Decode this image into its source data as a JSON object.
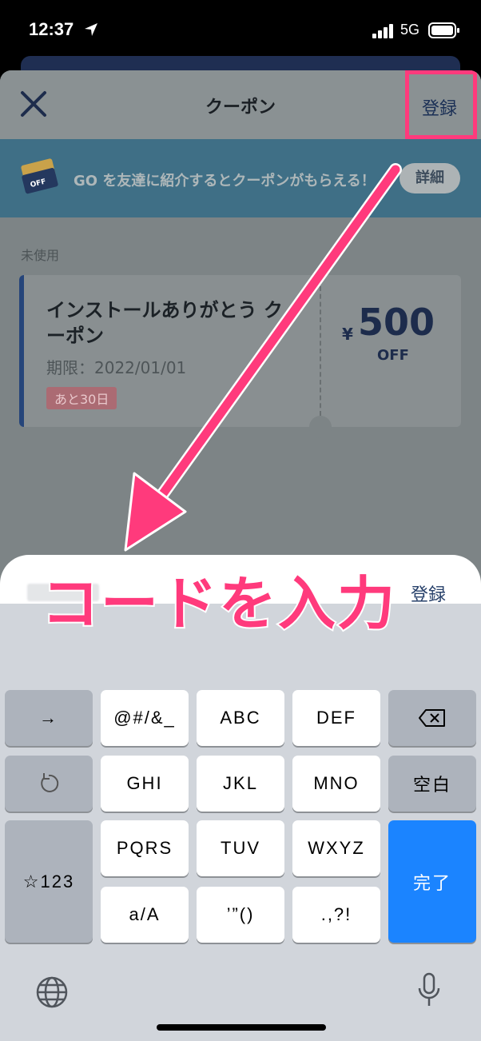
{
  "status_bar": {
    "time": "12:37",
    "network": "5G"
  },
  "header": {
    "title": "クーポン",
    "register_label": "登録"
  },
  "banner": {
    "text": "GO を友達に紹介するとクーポンがもらえる！",
    "details_label": "詳細",
    "ticket_text": "OFF"
  },
  "section_label": "未使用",
  "coupon": {
    "title": "インストールありがとう クーポン",
    "expiry": "期限：2022/01/01",
    "badge": "あと30日",
    "currency": "¥",
    "amount": "500",
    "off_label": "OFF"
  },
  "code_entry": {
    "register_label": "登録"
  },
  "annotation": {
    "text": "コードを入力",
    "color": "#ff3a7c"
  },
  "keyboard": {
    "arrow": "→",
    "symbols": "@#/&_",
    "abc": "ABC",
    "def": "DEF",
    "ghi": "GHI",
    "jkl": "JKL",
    "mno": "MNO",
    "space": "空白",
    "pqrs": "PQRS",
    "tuv": "TUV",
    "wxyz": "WXYZ",
    "num_mode": "☆123",
    "case": "a/A",
    "quotes": "’”()",
    "punct": ".,?!",
    "done": "完了"
  },
  "icons": [
    "location-arrow-icon",
    "signal-icon",
    "battery-icon",
    "close-icon",
    "ticket-icon",
    "backspace-icon",
    "undo-icon",
    "globe-icon",
    "microphone-icon"
  ]
}
